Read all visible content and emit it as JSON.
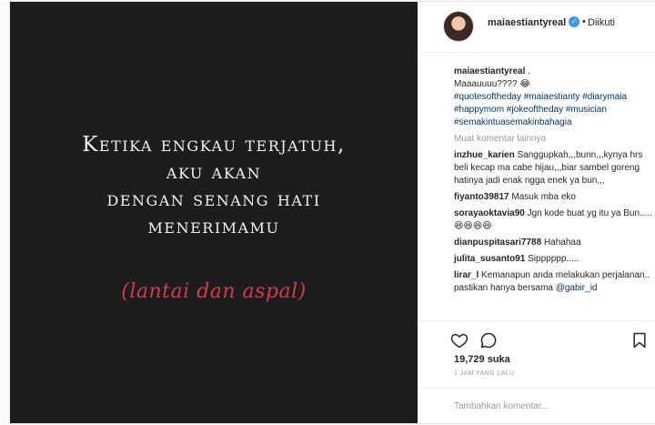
{
  "post_image": {
    "quote_lines": [
      "Ketika engkau terjatuh,",
      "aku akan",
      "dengan senang hati",
      "menerimamu"
    ],
    "punchline": "(lantai dan aspal)"
  },
  "header": {
    "username": "maiaestiantyreal",
    "verified_glyph": "✓",
    "separator": "•",
    "follow_status": "Diikuti"
  },
  "caption": {
    "username": "maiaestiantyreal",
    "text": ".",
    "line2": "Maaauuuu???? 😂",
    "hashtags": "#quotesoftheday #maiaestianty #diarymaia #happymom #jokeoftheday #musician #semakintuasemakinbahagia"
  },
  "load_more": "Muat komentar lainnya",
  "comments": [
    {
      "user": "inzhue_karien",
      "text": "Sanggupkah,,,bunn,,,kynya hrs beli kecap ma cabe hijau,,,biar sambel goreng hatinya jadi enak ngga enek ya bun,,,"
    },
    {
      "user": "fiyanto39817",
      "text": "Masuk mba eko"
    },
    {
      "user": "sorayaoktavia90",
      "text": "Jgn kode buat yg itu ya Bun.....😆😆😆😆"
    },
    {
      "user": "dianpuspitasari7788",
      "text": "Hahahaa"
    },
    {
      "user": "julita_susanto91",
      "text": "Sipppppp....."
    },
    {
      "user": "lirar_l",
      "text": "Kemanapun anda melakukan perjalanan.. pastikan hanya bersama",
      "mention": "@gabir_id"
    }
  ],
  "actions": {
    "like_icon": "heart-icon",
    "comment_icon": "comment-icon",
    "save_icon": "bookmark-icon"
  },
  "likes": "19,729 suka",
  "timestamp": "1 JAM YANG LALU",
  "add_comment": {
    "placeholder": "Tambahkan komentar..."
  },
  "colors": {
    "image_bg": "#1d1d1d",
    "punchline": "#d23a52",
    "link": "#003569",
    "verified": "#3897f0"
  }
}
